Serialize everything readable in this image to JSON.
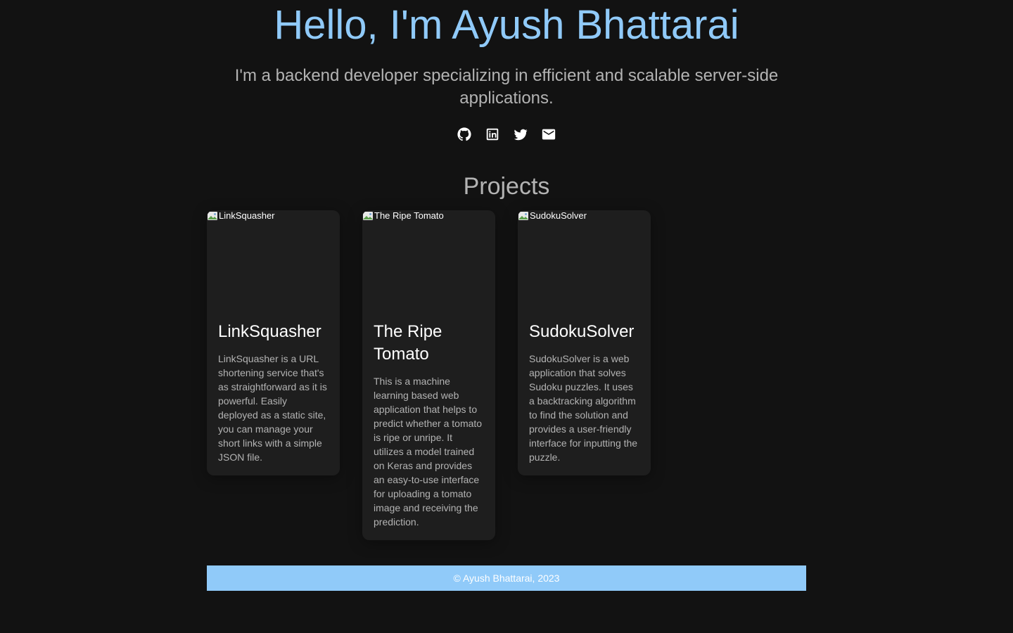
{
  "hero": {
    "title": "Hello, I'm Ayush Bhattarai",
    "subtitle": "I'm a backend developer specializing in efficient and scalable server-side applications."
  },
  "socials": [
    {
      "icon": "github-icon"
    },
    {
      "icon": "linkedin-icon"
    },
    {
      "icon": "twitter-icon"
    },
    {
      "icon": "mail-icon"
    }
  ],
  "projects": {
    "heading": "Projects",
    "items": [
      {
        "image_alt": "LinkSquasher",
        "title": "LinkSquasher",
        "description": "LinkSquasher is a URL shortening service that's as straightforward as it is powerful. Easily deployed as a static site, you can manage your short links with a simple JSON file."
      },
      {
        "image_alt": "The Ripe Tomato",
        "title": "The Ripe Tomato",
        "description": "This is a machine learning based web application that helps to predict whether a tomato is ripe or unripe. It utilizes a model trained on Keras and provides an easy-to-use interface for uploading a tomato image and receiving the prediction."
      },
      {
        "image_alt": "SudokuSolver",
        "title": "SudokuSolver",
        "description": "SudokuSolver is a web application that solves Sudoku puzzles. It uses a backtracking algorithm to find the solution and provides a user-friendly interface for inputting the puzzle."
      }
    ]
  },
  "footer": {
    "text": "© Ayush Bhattarai, 2023"
  },
  "colors": {
    "background": "#121212",
    "accent": "#90caf9",
    "card": "#1e1e1e",
    "muted_text": "#b3b3b3"
  }
}
